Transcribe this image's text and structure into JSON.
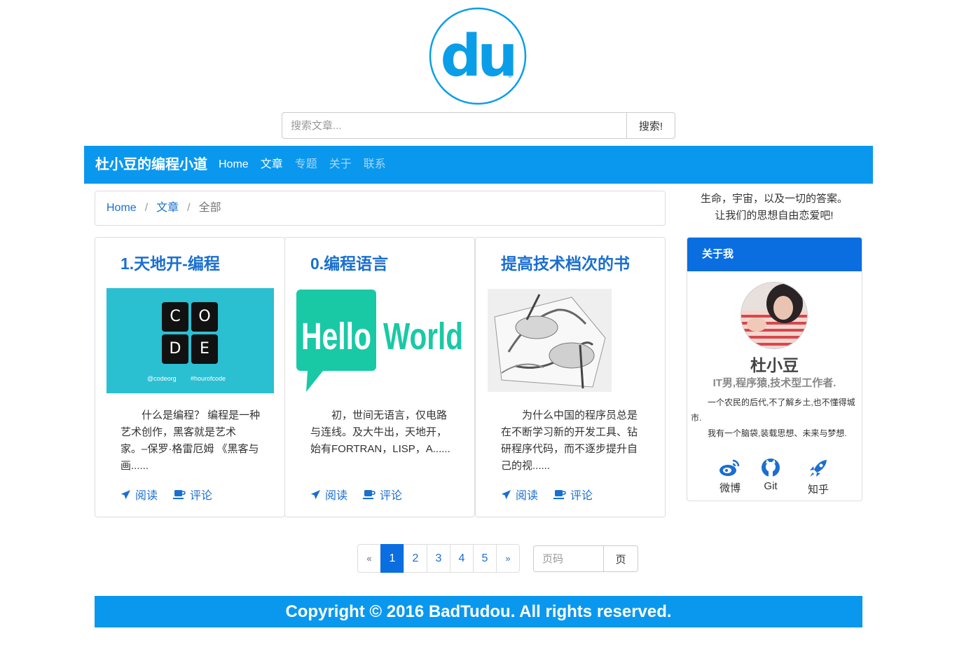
{
  "logo": {
    "text": "du",
    "mark": "®",
    "color": "#0a9ee8"
  },
  "search": {
    "placeholder": "搜索文章...",
    "button_label": "搜索!"
  },
  "navbar": {
    "brand": "杜小豆的编程小道",
    "items": [
      {
        "label": "Home"
      },
      {
        "label": "文章"
      },
      {
        "label": "专题"
      },
      {
        "label": "关于"
      },
      {
        "label": "联系"
      }
    ]
  },
  "breadcrumb": {
    "items": [
      "Home",
      "文章"
    ],
    "current": "全部",
    "separator": "/"
  },
  "articles": [
    {
      "title": "1.天地开-编程",
      "excerpt": "什么是编程？ 编程是一种艺术创作，黑客就是艺术家。–保罗·格雷厄姆 《黑客与画......",
      "image": {
        "letters": [
          "C",
          "O",
          "D",
          "E"
        ],
        "handle": "@codeorg",
        "tag": "#hourofcode"
      },
      "read_label": "阅读",
      "comment_label": "评论"
    },
    {
      "title": "0.编程语言",
      "excerpt": "初，世间无语言，仅电路与连线。及大牛出，天地开，始有FORTRAN，LISP，A......",
      "image": {
        "word1": "Hello",
        "word2": "World"
      },
      "read_label": "阅读",
      "comment_label": "评论"
    },
    {
      "title": "提高技术档次的书",
      "excerpt": "为什么中国的程序员总是在不断学习新的开发工具、钻研程序代码，而不逐步提升自己的视......",
      "image": {
        "alt": "drawing-hands"
      },
      "read_label": "阅读",
      "comment_label": "评论"
    }
  ],
  "sidebar": {
    "motto_line1": "生命，宇宙，以及一切的答案。",
    "motto_line2": "让我们的思想自由恋爱吧!",
    "about": {
      "title": "关于我",
      "name": "杜小豆",
      "tagline": "IT男,程序猿,技术型工作者.",
      "desc1": "一个农民的后代,不了解乡土,也不懂得城市.",
      "desc2": "我有一个脑袋,装载思想、未来与梦想.",
      "socials": [
        {
          "label": "微博",
          "icon": "weibo-icon"
        },
        {
          "label": "Git",
          "icon": "github-icon"
        },
        {
          "label": "知乎",
          "icon": "rocket-icon"
        }
      ]
    }
  },
  "pagination": {
    "prev": "«",
    "pages": [
      "1",
      "2",
      "3",
      "4",
      "5"
    ],
    "active": "1",
    "next": "»",
    "jump_placeholder": "页码",
    "jump_button": "页"
  },
  "footer": {
    "text": "Copyright © 2016 BadTudou. All rights reserved."
  },
  "colors": {
    "primary": "#0a98ee",
    "panel_header": "#0a6ee0",
    "link": "#1a6fd0"
  }
}
